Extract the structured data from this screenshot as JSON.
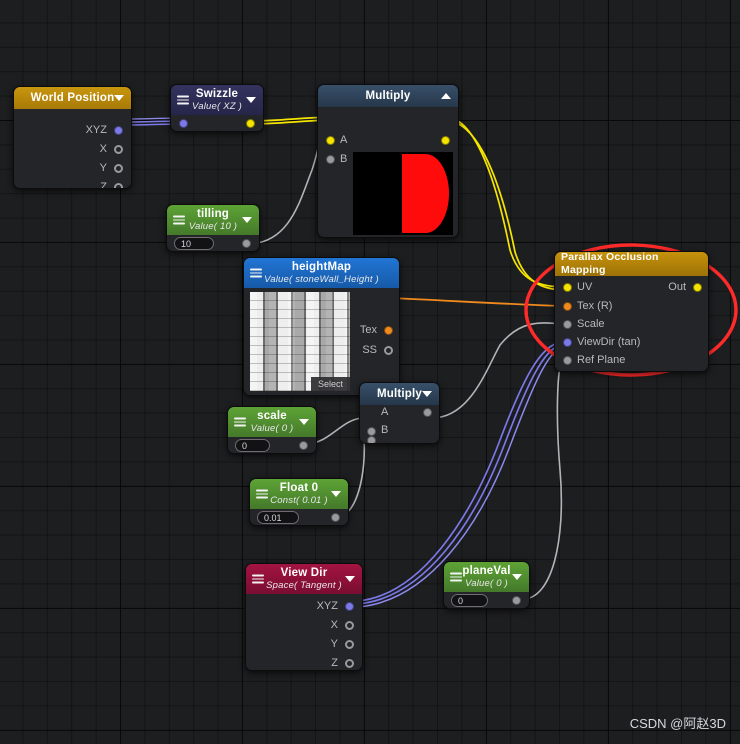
{
  "app": {
    "editor": "shader-graph",
    "watermark": "CSDN @阿赵3D"
  },
  "colors": {
    "background": "#1d1e20",
    "node_body": "#242528",
    "header_gold": "#b8860b",
    "header_indigo": "#2c2b57",
    "header_green": "#4e8c2b",
    "header_blue": "#1a5fb4",
    "header_slate": "#2d3f55",
    "header_crimson": "#8e1038",
    "wire_yellow": "#f5e400",
    "wire_orange": "#f08a1e",
    "wire_purple": "#7b78e8",
    "wire_gray": "#b4b4b8",
    "port_yellow": "#f5e400",
    "port_orange": "#f08a1e",
    "port_purple": "#7b78e8",
    "port_gray": "#9a9a9e",
    "annotation_red": "#ff2a2a"
  },
  "nodes": [
    {
      "id": "world-position",
      "title": "World Position",
      "subtitle": "",
      "header_color": "#b8860b",
      "outputs": [
        {
          "label": "XYZ",
          "color": "purple",
          "connected": true
        },
        {
          "label": "X",
          "color": "gray",
          "connected": false
        },
        {
          "label": "Y",
          "color": "gray",
          "connected": false
        },
        {
          "label": "Z",
          "color": "gray",
          "connected": false
        }
      ]
    },
    {
      "id": "swizzle",
      "title": "Swizzle",
      "subtitle": "Value( XZ )",
      "header_color": "#2c2b57",
      "inputs": [
        {
          "label": "",
          "color": "purple",
          "connected": true
        }
      ],
      "outputs": [
        {
          "label": "",
          "color": "yellow",
          "connected": true
        }
      ]
    },
    {
      "id": "multiply-uv",
      "title": "Multiply",
      "subtitle": "",
      "header_color": "#2d3f55",
      "expanded": true,
      "inputs": [
        {
          "label": "A",
          "color": "yellow",
          "connected": true
        },
        {
          "label": "B",
          "color": "gray",
          "connected": true
        }
      ],
      "outputs": [
        {
          "label": "",
          "color": "yellow",
          "connected": true
        }
      ],
      "preview": "red-half-circle"
    },
    {
      "id": "tilling",
      "title": "tilling",
      "subtitle": "Value( 10 )",
      "header_color": "#4e8c2b",
      "value": "10",
      "outputs": [
        {
          "label": "",
          "color": "gray",
          "connected": true
        }
      ]
    },
    {
      "id": "height-map",
      "title": "heightMap",
      "subtitle": "Value( stoneWall_Height )",
      "header_color": "#1a5fb4",
      "thumbnail": "stone-wall-height-texture",
      "select_label": "Select",
      "outputs": [
        {
          "label": "Tex",
          "color": "orange",
          "connected": true
        },
        {
          "label": "SS",
          "color": "gray",
          "connected": false
        }
      ]
    },
    {
      "id": "parallax-occlusion-mapping",
      "title": "Parallax Occlusion Mapping",
      "subtitle": "",
      "header_color": "#b8860b",
      "highlighted": true,
      "inputs": [
        {
          "label": "UV",
          "color": "yellow",
          "connected": true
        },
        {
          "label": "Tex (R)",
          "color": "orange",
          "connected": true
        },
        {
          "label": "Scale",
          "color": "gray",
          "connected": true
        },
        {
          "label": "ViewDir (tan)",
          "color": "purple",
          "connected": true
        },
        {
          "label": "Ref Plane",
          "color": "gray",
          "connected": true
        }
      ],
      "outputs": [
        {
          "label": "Out",
          "color": "yellow",
          "connected": true
        }
      ]
    },
    {
      "id": "scale",
      "title": "scale",
      "subtitle": "Value( 0 )",
      "header_color": "#4e8c2b",
      "value": "0",
      "outputs": [
        {
          "label": "",
          "color": "gray",
          "connected": true
        }
      ]
    },
    {
      "id": "multiply-scale",
      "title": "Multiply",
      "subtitle": "",
      "header_color": "#2d3f55",
      "expanded": false,
      "inputs": [
        {
          "label": "A",
          "color": "gray",
          "connected": true
        },
        {
          "label": "B",
          "color": "gray",
          "connected": true
        }
      ],
      "outputs": [
        {
          "label": "",
          "color": "gray",
          "connected": true
        }
      ]
    },
    {
      "id": "float-0",
      "title": "Float 0",
      "subtitle": "Const( 0.01 )",
      "header_color": "#4e8c2b",
      "value": "0.01",
      "outputs": [
        {
          "label": "",
          "color": "gray",
          "connected": true
        }
      ]
    },
    {
      "id": "view-dir",
      "title": "View Dir",
      "subtitle": "Space( Tangent )",
      "header_color": "#8e1038",
      "outputs": [
        {
          "label": "XYZ",
          "color": "purple",
          "connected": true
        },
        {
          "label": "X",
          "color": "gray",
          "connected": false
        },
        {
          "label": "Y",
          "color": "gray",
          "connected": false
        },
        {
          "label": "Z",
          "color": "gray",
          "connected": false
        }
      ]
    },
    {
      "id": "plane-val",
      "title": "planeVal",
      "subtitle": "Value( 0 )",
      "header_color": "#4e8c2b",
      "value": "0",
      "outputs": [
        {
          "label": "",
          "color": "gray",
          "connected": true
        }
      ]
    }
  ],
  "connections": [
    {
      "from": "world-position.XYZ",
      "to": "swizzle.in",
      "color": "purple"
    },
    {
      "from": "swizzle.out",
      "to": "multiply-uv.A",
      "color": "yellow"
    },
    {
      "from": "tilling.out",
      "to": "multiply-uv.B",
      "color": "gray"
    },
    {
      "from": "multiply-uv.out",
      "to": "parallax-occlusion-mapping.UV",
      "color": "yellow"
    },
    {
      "from": "height-map.Tex",
      "to": "parallax-occlusion-mapping.Tex (R)",
      "color": "orange"
    },
    {
      "from": "scale.out",
      "to": "multiply-scale.A",
      "color": "gray"
    },
    {
      "from": "float-0.out",
      "to": "multiply-scale.B",
      "color": "gray"
    },
    {
      "from": "multiply-scale.out",
      "to": "parallax-occlusion-mapping.Scale",
      "color": "gray"
    },
    {
      "from": "view-dir.XYZ",
      "to": "parallax-occlusion-mapping.ViewDir (tan)",
      "color": "purple"
    },
    {
      "from": "plane-val.out",
      "to": "parallax-occlusion-mapping.Ref Plane",
      "color": "gray"
    }
  ],
  "annotation": {
    "type": "ellipse-highlight",
    "color": "#ff2a2a",
    "target": "parallax-occlusion-mapping"
  }
}
